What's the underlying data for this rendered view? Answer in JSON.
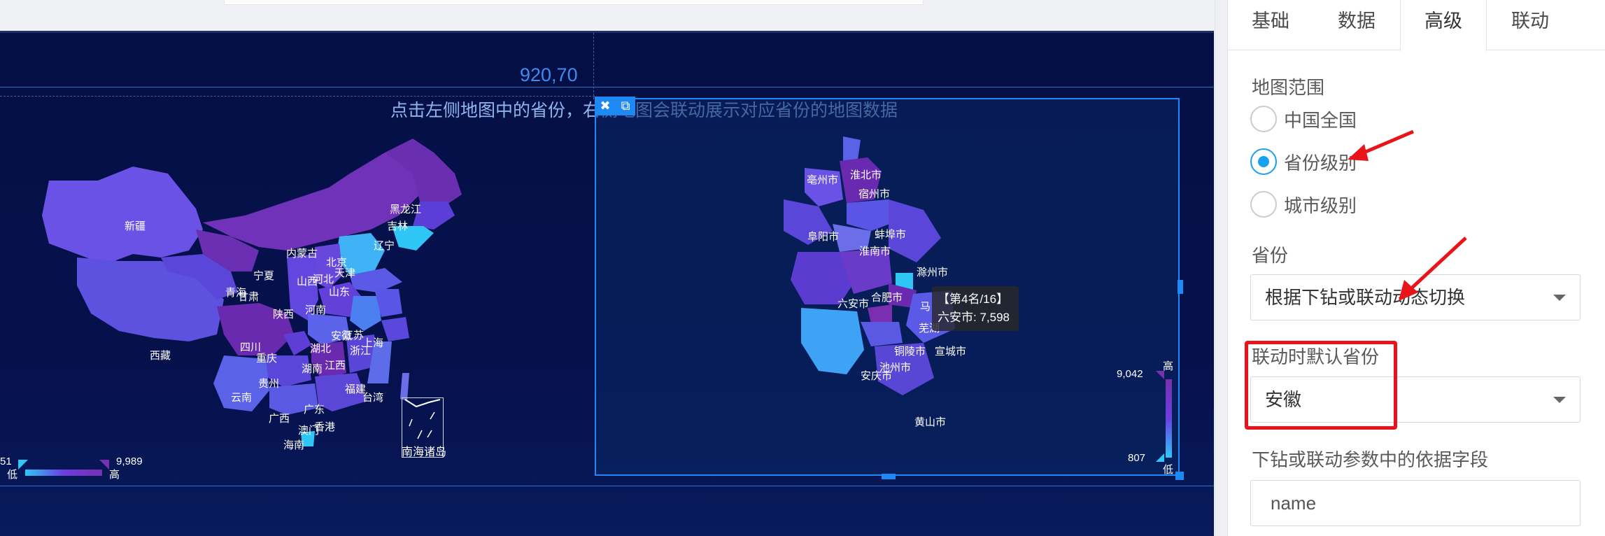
{
  "canvas": {
    "coord_readout": "920,70",
    "hint_text": "点击左侧地图中的省份，右侧地图会联动展示对应省份的地图数据"
  },
  "china_map": {
    "labels": [
      "新疆",
      "西藏",
      "青海",
      "甘肃",
      "宁夏",
      "内蒙古",
      "黑龙江",
      "吉林",
      "辽宁",
      "北京",
      "天津",
      "河北",
      "山西",
      "山东",
      "陕西",
      "河南",
      "四川",
      "重庆",
      "湖北",
      "安徽",
      "江苏",
      "上海",
      "浙江",
      "湖南",
      "江西",
      "贵州",
      "云南",
      "广西",
      "广东",
      "福建",
      "台湾",
      "香港",
      "澳门",
      "海南",
      "南海诸岛"
    ],
    "legend": {
      "min": "51",
      "max": "9,989",
      "low_label": "低",
      "high_label": "高"
    }
  },
  "widget_toolbar": {
    "close_glyph": "✖",
    "copy_glyph": "⧉"
  },
  "anhui_map": {
    "labels": [
      "亳州市",
      "淮北市",
      "宿州市",
      "阜阳市",
      "蚌埠市",
      "淮南市",
      "滁州市",
      "六安市",
      "合肥市",
      "马",
      "芜湖",
      "铜陵市",
      "宣城市",
      "池州市",
      "安庆市",
      "黄山市"
    ],
    "tooltip": {
      "rank": "【第4名/16】",
      "value": "六安市: 7,598"
    },
    "legend": {
      "max": "9,042",
      "min": "807",
      "high_label": "高",
      "low_label": "低"
    }
  },
  "panel": {
    "tabs": [
      {
        "label": "基础",
        "active": false
      },
      {
        "label": "数据",
        "active": false
      },
      {
        "label": "高级",
        "active": true
      },
      {
        "label": "联动",
        "active": false
      }
    ],
    "map_range": {
      "label": "地图范围",
      "options": [
        {
          "label": "中国全国",
          "checked": false
        },
        {
          "label": "省份级别",
          "checked": true
        },
        {
          "label": "城市级别",
          "checked": false
        }
      ]
    },
    "province": {
      "label": "省份",
      "value": "根据下钻或联动动态切换"
    },
    "default_province": {
      "label": "联动时默认省份",
      "value": "安徽"
    },
    "basis_field": {
      "label": "下钻或联动参数中的依据字段",
      "value": "name"
    }
  },
  "colors": {
    "accent": "#1aa0f0",
    "annotation_red": "#e8141a",
    "board_bg": "#050f45",
    "selection_blue": "#1e88f5"
  }
}
